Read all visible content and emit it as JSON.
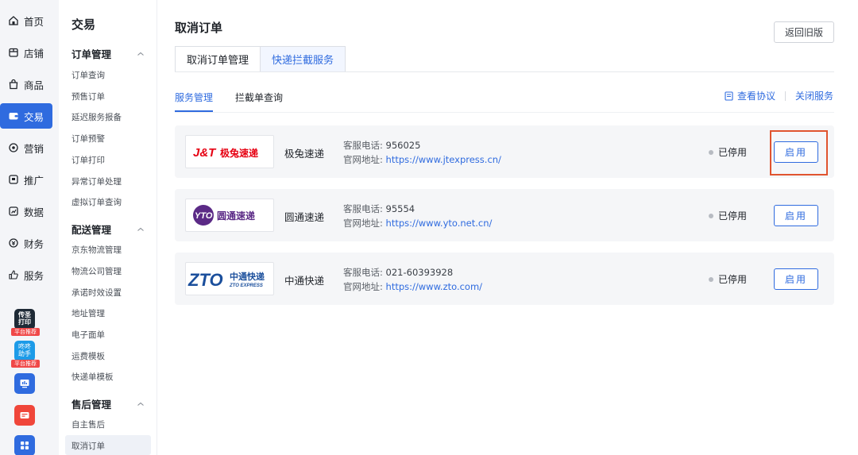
{
  "rail": {
    "items": [
      {
        "label": "首页",
        "icon": "home-icon"
      },
      {
        "label": "店铺",
        "icon": "shop-icon"
      },
      {
        "label": "商品",
        "icon": "bag-icon"
      },
      {
        "label": "交易",
        "icon": "wallet-icon"
      },
      {
        "label": "营销",
        "icon": "target-icon"
      },
      {
        "label": "推广",
        "icon": "megaphone-icon"
      },
      {
        "label": "数据",
        "icon": "chart-icon"
      },
      {
        "label": "财务",
        "icon": "finance-icon"
      },
      {
        "label": "服务",
        "icon": "thumb-icon"
      }
    ],
    "apps": [
      {
        "label": "传圣打印",
        "tag": "平台推荐"
      },
      {
        "label": "咚咚助手",
        "tag": "平台推荐"
      }
    ]
  },
  "subnav": {
    "title": "交易",
    "groups": [
      {
        "label": "订单管理",
        "items": [
          "订单查询",
          "预售订单",
          "延迟服务报备",
          "订单预警",
          "订单打印",
          "异常订单处理",
          "虚拟订单查询"
        ]
      },
      {
        "label": "配送管理",
        "items": [
          "京东物流管理",
          "物流公司管理",
          "承诺时效设置",
          "地址管理",
          "电子面单",
          "运费模板",
          "快递单模板"
        ]
      },
      {
        "label": "售后管理",
        "items": [
          "自主售后",
          "取消订单"
        ]
      }
    ]
  },
  "main": {
    "title": "取消订单",
    "legacy_label": "返回旧版",
    "tabs": [
      "取消订单管理",
      "快递拦截服务"
    ],
    "subtabs": [
      "服务管理",
      "拦截单查询"
    ],
    "links": {
      "agreement": "查看协议",
      "close": "关闭服务"
    },
    "phone_label": "客服电话:",
    "site_label": "官网地址:",
    "carriers": [
      {
        "name": "极兔速递",
        "phone": "956025",
        "url": "https://www.jtexpress.cn/",
        "status": "已停用",
        "action": "启用",
        "logo": "J&T极兔速递"
      },
      {
        "name": "圆通速递",
        "phone": "95554",
        "url": "https://www.yto.net.cn/",
        "status": "已停用",
        "action": "启用",
        "logo": "圆通速递"
      },
      {
        "name": "中通快递",
        "phone": "021-60393928",
        "url": "https://www.zto.com/",
        "status": "已停用",
        "action": "启用",
        "logo": "ZTO中通快递"
      }
    ]
  },
  "colors": {
    "accent": "#2f6bdf",
    "highlight": "#e0542f",
    "jt_red": "#e60012",
    "yto_purple": "#5b2a86",
    "zto_blue": "#1b4f9c"
  }
}
